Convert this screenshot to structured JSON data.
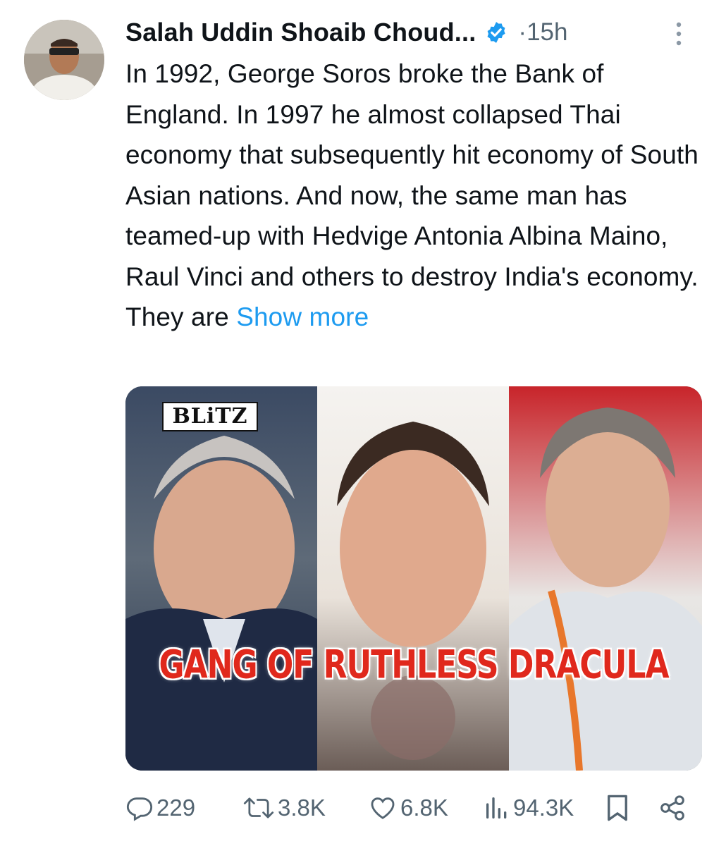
{
  "author": {
    "display_name": "Salah Uddin Shoaib Choud...",
    "dot": "·",
    "time": "15h"
  },
  "tweet": {
    "text": "In 1992, George Soros broke the Bank of England. In 1997 he almost collapsed Thai economy that subsequently hit economy of South Asian nations. And now, the same man has teamed-up with Hedvige Antonia Albina Maino, Raul Vinci and others to destroy India's economy. They are",
    "show_more": "Show more"
  },
  "media": {
    "logo_text": "BLiTZ",
    "caption": "GANG OF RUTHLESS DRACULA"
  },
  "actions": {
    "replies": "229",
    "reposts": "3.8K",
    "likes": "6.8K",
    "views": "94.3K"
  },
  "icons": {
    "verified": "verified-badge-icon",
    "more": "more-vertical-icon",
    "reply": "reply-icon",
    "repost": "repost-icon",
    "like": "heart-icon",
    "views": "views-icon",
    "bookmark": "bookmark-icon",
    "share": "share-icon"
  },
  "colors": {
    "accent": "#1d9bf0",
    "muted": "#536471",
    "text": "#0f1419",
    "caption_red": "#e0281c"
  }
}
